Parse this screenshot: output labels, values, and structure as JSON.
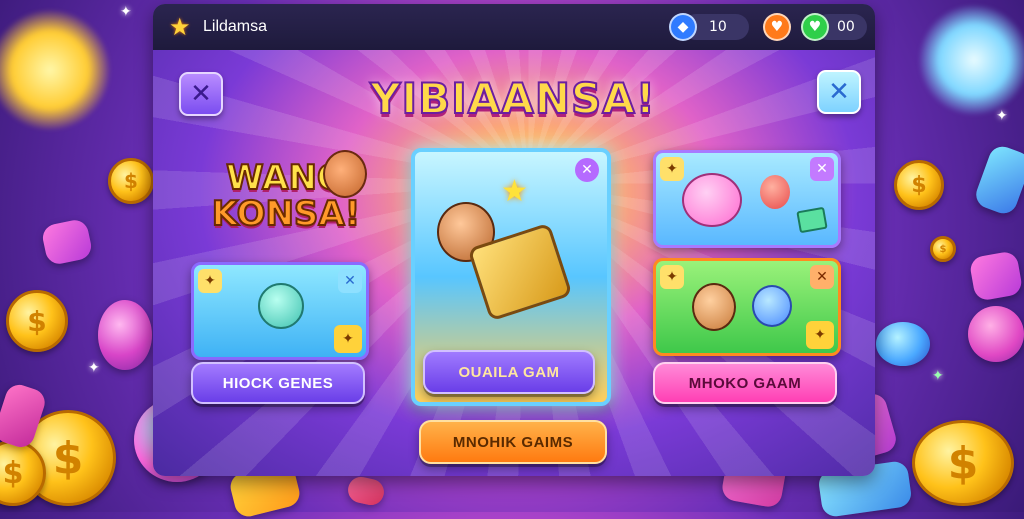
{
  "app": {
    "title": "Lildamsa",
    "icon": "star-mascot-icon"
  },
  "currency": {
    "blue": {
      "icon": "blue-gem-icon",
      "glyph": "◆",
      "value": "10"
    },
    "orange": {
      "icon": "orange-heart-icon",
      "glyph": "♥",
      "value": ""
    },
    "green": {
      "icon": "green-heart-icon",
      "glyph": "♥",
      "value": "00"
    }
  },
  "buttons": {
    "close_left": {
      "icon": "close-icon",
      "glyph": "✕"
    },
    "close_right": {
      "icon": "close-icon",
      "glyph": "✕"
    }
  },
  "headline": "YIBIAANSA!",
  "logo": {
    "line1": "WANO",
    "line2": "KONSA!"
  },
  "cards": {
    "left": {
      "label": "HIOCK GENES",
      "badge": "✕"
    },
    "center": {
      "label": "OUAILA GAM",
      "badge": "✕"
    },
    "right_top": {
      "badge": "✕"
    },
    "right_bottom": {
      "badge": "✕",
      "label": "MHOKO GAAM"
    }
  },
  "bottom_button": "MNOHIK GAIMS",
  "colors": {
    "accent_purple": "#6b2fb8",
    "pill_purple": "#7b4df0",
    "pill_pink": "#ff5ec4",
    "pill_orange": "#ff8a1f",
    "gold": "#ffc21a"
  }
}
